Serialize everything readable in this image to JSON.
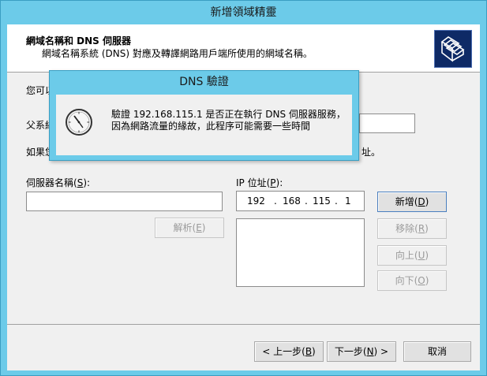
{
  "window": {
    "title": "新增領域精靈"
  },
  "header": {
    "title": "網域名稱和 DNS 伺服器",
    "subtitle": "網域名稱系統 (DNS) 對應及轉譯網路用戶端所使用的網域名稱。",
    "icon": "folder-stack-icon"
  },
  "body": {
    "intro_fragment": "您可以",
    "parent_label_fragment": "父系網",
    "info_fragment_left": "如果您",
    "info_fragment_right": "址。"
  },
  "server": {
    "label": "伺服器名稱(",
    "mnemonic": "S",
    "label_end": "):",
    "value": ""
  },
  "resolve_button": {
    "label": "解析(",
    "mnemonic": "E",
    "end": ")"
  },
  "ip": {
    "label": "IP 位址(",
    "mnemonic": "P",
    "label_end": "):",
    "octets": [
      "192",
      "168",
      "115",
      "1"
    ],
    "dots": [
      ".",
      ".",
      "."
    ]
  },
  "buttons": {
    "add": {
      "label": "新增(",
      "mnemonic": "D",
      "end": ")"
    },
    "remove": {
      "label": "移除(",
      "mnemonic": "R",
      "end": ")"
    },
    "up": {
      "label": "向上(",
      "mnemonic": "U",
      "end": ")"
    },
    "down": {
      "label": "向下(",
      "mnemonic": "O",
      "end": ")"
    }
  },
  "footer": {
    "back": {
      "label": "< 上一步(",
      "mnemonic": "B",
      "end": ")"
    },
    "next": {
      "label": "下一步(",
      "mnemonic": "N",
      "end": ") >"
    },
    "cancel": "取消"
  },
  "dialog": {
    "title": "DNS 驗證",
    "icon": "clock-icon",
    "line1": "驗證 192.168.115.1 是否正在執行 DNS 伺服器服務，",
    "line2": "因為網路流量的緣故，此程序可能需要一些時間"
  },
  "colors": {
    "titlebar": "#6ccbe9",
    "face": "#f0f0f0",
    "header_icon_bg": "#0e2a66"
  }
}
